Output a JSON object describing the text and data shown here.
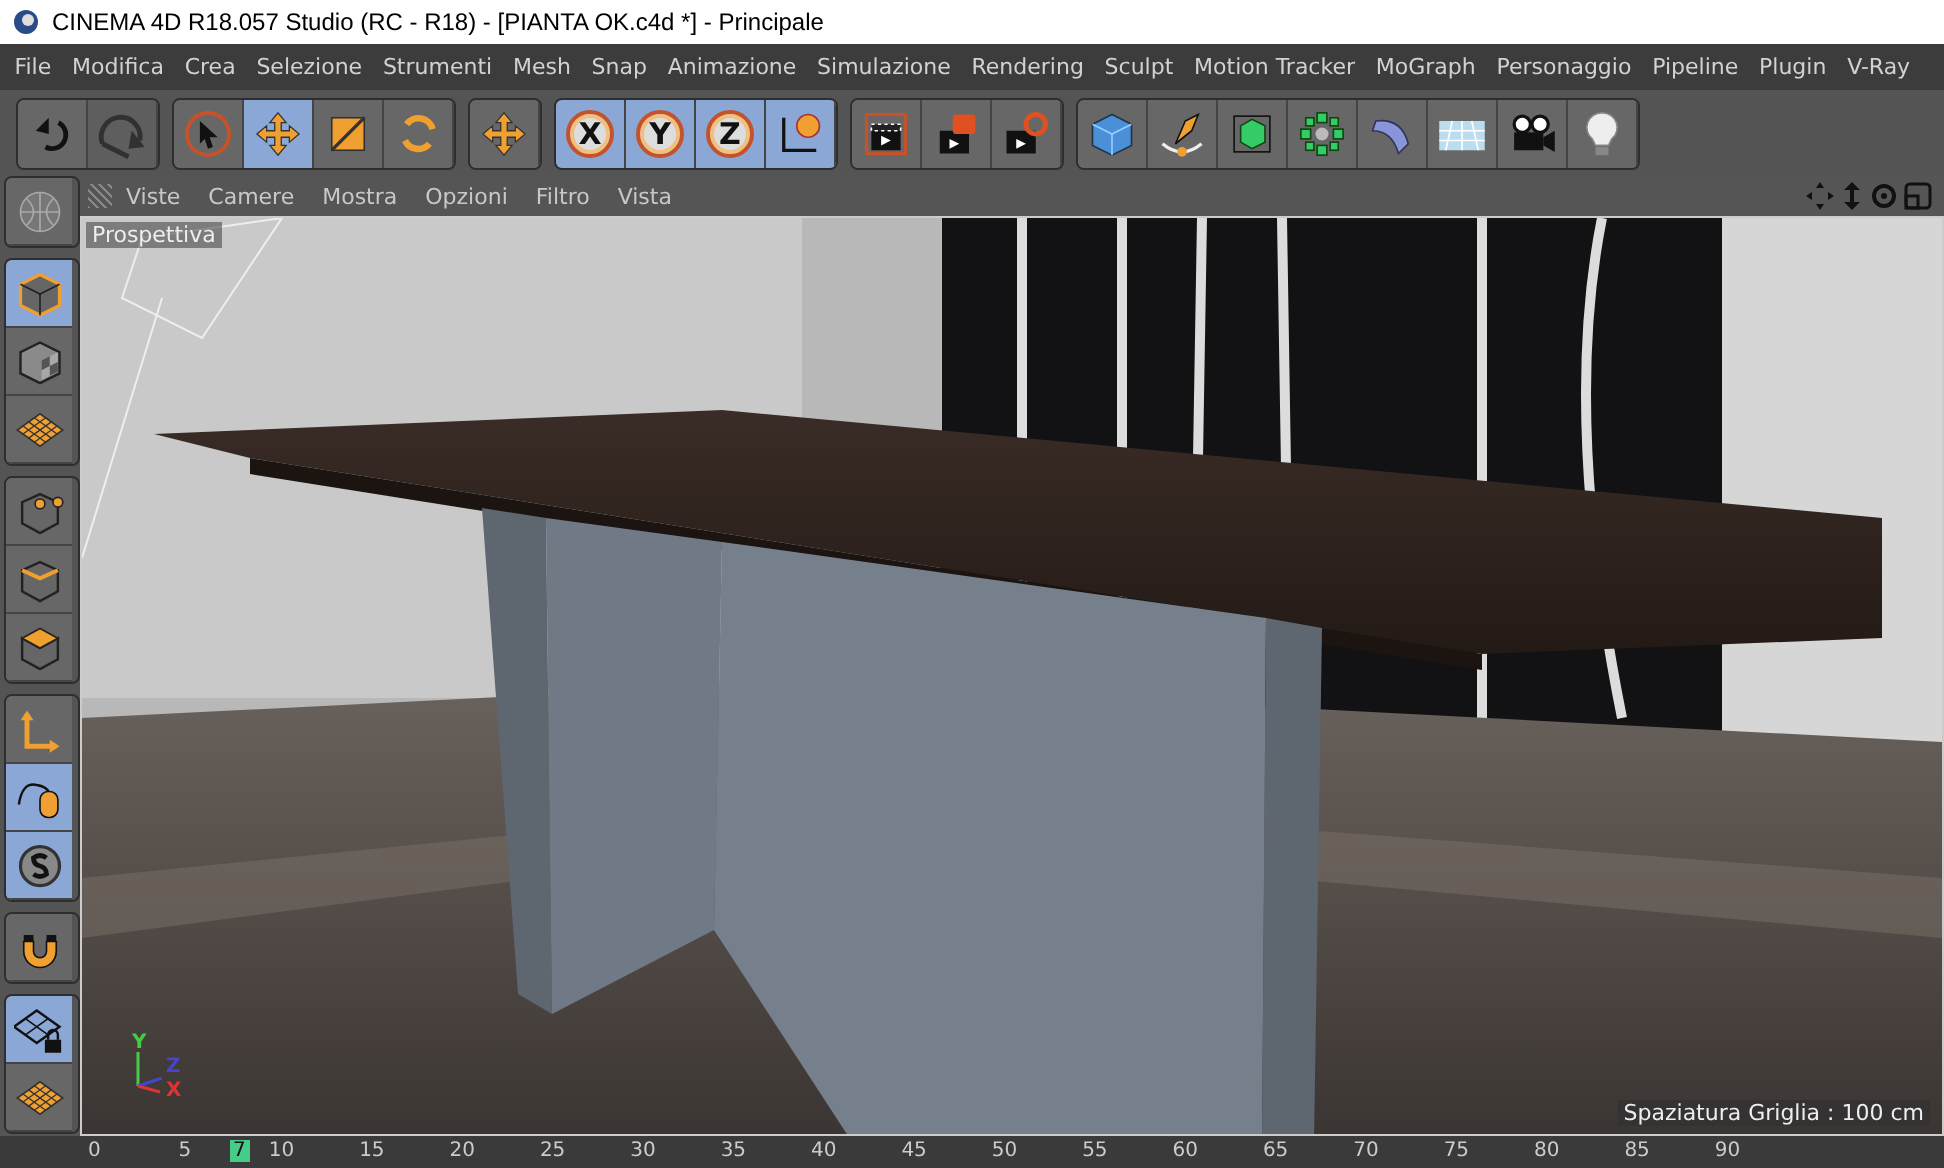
{
  "window": {
    "title": "CINEMA 4D R18.057 Studio (RC - R18) - [PIANTA OK.c4d *] - Principale"
  },
  "menu": [
    "File",
    "Modifica",
    "Crea",
    "Selezione",
    "Strumenti",
    "Mesh",
    "Snap",
    "Animazione",
    "Simulazione",
    "Rendering",
    "Sculpt",
    "Motion Tracker",
    "MoGraph",
    "Personaggio",
    "Pipeline",
    "Plugin",
    "V-Ray"
  ],
  "toolbar": [
    {
      "items": [
        {
          "kind": "undo",
          "selected": false,
          "disabled": false
        },
        {
          "kind": "redo",
          "selected": false,
          "disabled": true
        }
      ]
    },
    {
      "items": [
        {
          "kind": "select",
          "selected": false,
          "disabled": false
        },
        {
          "kind": "move",
          "selected": true,
          "disabled": false
        },
        {
          "kind": "scale",
          "selected": false,
          "disabled": false
        },
        {
          "kind": "rotate",
          "selected": false,
          "disabled": false
        }
      ]
    },
    {
      "items": [
        {
          "kind": "move",
          "selected": false,
          "disabled": false
        }
      ]
    },
    {
      "items": [
        {
          "kind": "axis",
          "label": "X",
          "selected": true,
          "disabled": false
        },
        {
          "kind": "axis",
          "label": "Y",
          "selected": true,
          "disabled": false
        },
        {
          "kind": "axis",
          "label": "Z",
          "selected": true,
          "disabled": false
        },
        {
          "kind": "world",
          "selected": true,
          "disabled": false
        }
      ]
    },
    {
      "items": [
        {
          "kind": "render-view",
          "selected": false,
          "disabled": false
        },
        {
          "kind": "render",
          "selected": false,
          "disabled": false
        },
        {
          "kind": "render-settings",
          "selected": false,
          "disabled": false
        }
      ]
    },
    {
      "items": [
        {
          "kind": "cube",
          "selected": false,
          "disabled": false
        },
        {
          "kind": "pen",
          "selected": false,
          "disabled": false
        },
        {
          "kind": "subdivision",
          "selected": false,
          "disabled": false
        },
        {
          "kind": "cloner",
          "selected": false,
          "disabled": false
        },
        {
          "kind": "bend",
          "selected": false,
          "disabled": false
        },
        {
          "kind": "floor",
          "selected": false,
          "disabled": false
        },
        {
          "kind": "camera",
          "selected": false,
          "disabled": false
        },
        {
          "kind": "light",
          "selected": false,
          "disabled": false
        }
      ]
    }
  ],
  "side_toolbar": [
    {
      "items": [
        {
          "kind": "globe",
          "selected": false
        }
      ]
    },
    {
      "items": [
        {
          "kind": "model",
          "selected": true
        },
        {
          "kind": "texture",
          "selected": false
        },
        {
          "kind": "grid-plane",
          "selected": false
        }
      ]
    },
    {
      "items": [
        {
          "kind": "points",
          "selected": false
        },
        {
          "kind": "edges",
          "selected": false
        },
        {
          "kind": "polygons",
          "selected": false
        }
      ]
    },
    {
      "items": [
        {
          "kind": "axes",
          "selected": false
        },
        {
          "kind": "mouse",
          "selected": true
        },
        {
          "kind": "solo",
          "selected": true
        }
      ]
    },
    {
      "items": [
        {
          "kind": "magnet",
          "selected": false
        }
      ]
    },
    {
      "items": [
        {
          "kind": "grid-lock",
          "selected": true
        },
        {
          "kind": "grid-plane",
          "selected": false
        }
      ]
    }
  ],
  "viewport": {
    "menu": [
      "Viste",
      "Camere",
      "Mostra",
      "Opzioni",
      "Filtro",
      "Vista"
    ],
    "camera_label": "Prospettiva",
    "grid_spacing": "Spaziatura Griglia : 100 cm",
    "axis_labels": [
      "Y",
      "Z",
      "X"
    ]
  },
  "timeline": {
    "ticks": [
      "0",
      "5",
      "10",
      "15",
      "20",
      "25",
      "30",
      "35",
      "40",
      "45",
      "50",
      "55",
      "60",
      "65",
      "70",
      "75",
      "80",
      "85",
      "90"
    ],
    "current": "7",
    "level": 0.078
  }
}
